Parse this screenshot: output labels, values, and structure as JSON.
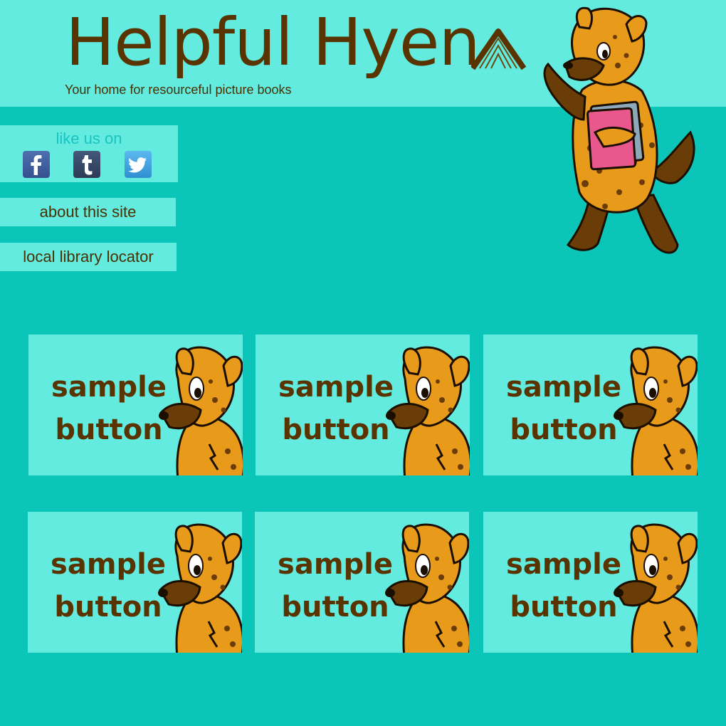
{
  "header": {
    "title": "Helpful Hyen",
    "tagline": "Your home for resourceful picture books"
  },
  "social": {
    "label": "like us on",
    "icons": [
      {
        "name": "facebook-icon",
        "glyph": "f"
      },
      {
        "name": "tumblr-icon",
        "glyph": "t"
      },
      {
        "name": "twitter-icon",
        "glyph": "bird"
      }
    ]
  },
  "nav": {
    "about": "about this site",
    "library": "local library locator"
  },
  "buttons": [
    {
      "line1": "sample",
      "line2": "button"
    },
    {
      "line1": "sample",
      "line2": "button"
    },
    {
      "line1": "sample",
      "line2": "button"
    },
    {
      "line1": "sample",
      "line2": "button"
    },
    {
      "line1": "sample",
      "line2": "button"
    },
    {
      "line1": "sample",
      "line2": "button"
    }
  ],
  "colors": {
    "background": "#0bc6b8",
    "panel": "#63ebe0",
    "brown_text": "#5a3400",
    "label_teal": "#19c3c0",
    "hyena_orange": "#e89a1a",
    "hyena_dark": "#5a3000",
    "book_pink": "#e9588d"
  }
}
